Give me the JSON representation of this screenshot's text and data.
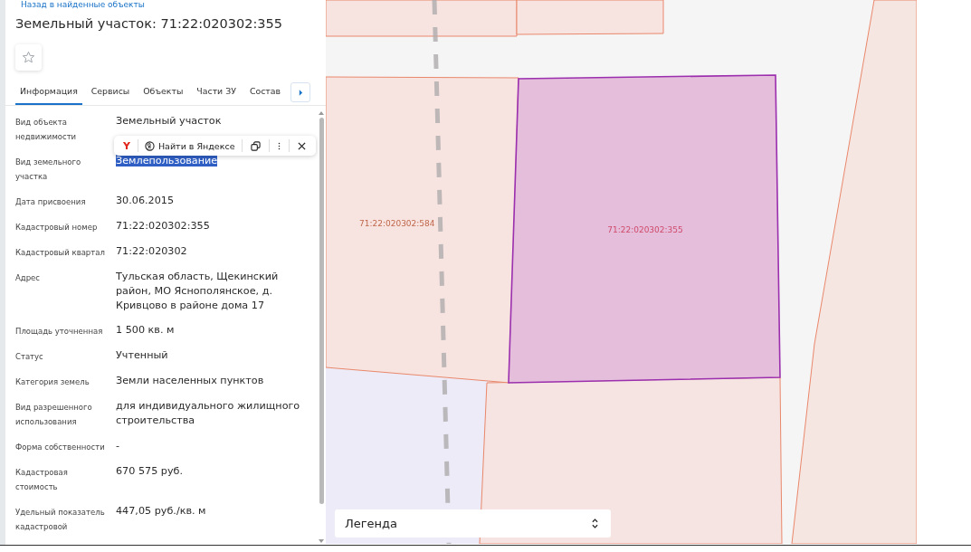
{
  "back_link": "Назад в найденные объекты",
  "title": "Земельный участок: 71:22:020302:355",
  "starred": false,
  "tabs": [
    {
      "label": "Информация",
      "selected": true
    },
    {
      "label": "Сервисы",
      "selected": false
    },
    {
      "label": "Объекты",
      "selected": false
    },
    {
      "label": "Части ЗУ",
      "selected": false
    },
    {
      "label": "Состав",
      "selected": false
    }
  ],
  "properties": [
    {
      "label": "Вид объекта недвижимости",
      "value": "Земельный участок",
      "highlighted": false
    },
    {
      "label": "Вид земельного участка",
      "value": "Землепользование",
      "highlighted": true
    },
    {
      "label": "Дата присвоения",
      "value": "30.06.2015",
      "highlighted": false
    },
    {
      "label": "Кадастровый номер",
      "value": "71:22:020302:355",
      "highlighted": false
    },
    {
      "label": "Кадастровый квартал",
      "value": "71:22:020302",
      "highlighted": false
    },
    {
      "label": "Адрес",
      "value": "Тульская область, Щекинский район, МО Яснополянское, д. Кривцово в районе дома 17",
      "highlighted": false
    },
    {
      "label": "Площадь уточненная",
      "value": "1 500 кв. м",
      "highlighted": false
    },
    {
      "label": "Статус",
      "value": "Учтенный",
      "highlighted": false
    },
    {
      "label": "Категория земель",
      "value": "Земли населенных пунктов",
      "highlighted": false
    },
    {
      "label": "Вид разрешенного использования",
      "value": "для индивидуального жилищного строительства",
      "highlighted": false
    },
    {
      "label": "Форма собственности",
      "value": "-",
      "highlighted": false
    },
    {
      "label": "Кадастровая стоимость",
      "value": "670 575 руб.",
      "highlighted": false
    },
    {
      "label": "Удельный показатель кадастровой",
      "value": "447,05 руб./кв. м",
      "highlighted": false
    }
  ],
  "selection_popup": {
    "logo": "Y",
    "search_label": "Найти в Яндексе"
  },
  "map": {
    "parcels": [
      {
        "label": "71:22:020302:584",
        "kind": "neighbor"
      },
      {
        "label": "71:22:020302:355",
        "kind": "selected"
      }
    ],
    "legend": "Легенда"
  }
}
